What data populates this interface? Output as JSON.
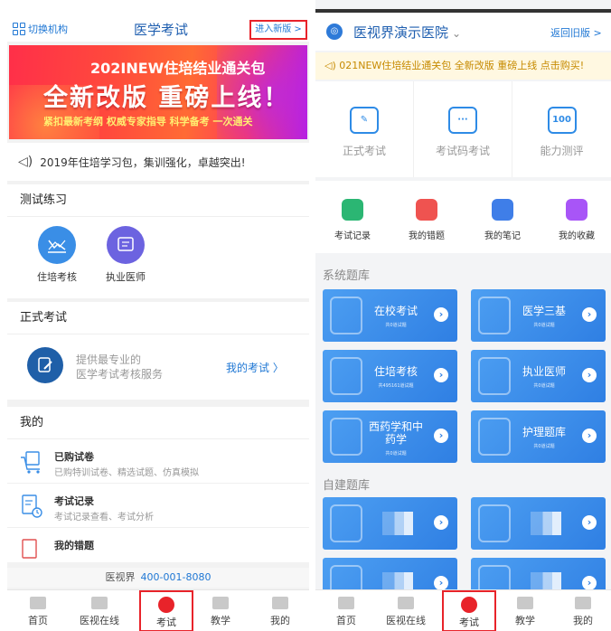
{
  "left": {
    "header": {
      "switch_label": "切换机构",
      "title": "医学考试",
      "new_version_label": "进入新版 >"
    },
    "banner": {
      "line1": "202INEW住培结业通关包",
      "line2": "全新改版 重磅上线！",
      "line3": "紧扣最新考纲  权威专家指导  科学备考  一次通关"
    },
    "notice": "2019年住培学习包，集训强化，卓越突出!",
    "practice": {
      "title": "测试练习",
      "items": [
        {
          "label": "住培考核"
        },
        {
          "label": "执业医师"
        }
      ]
    },
    "formal": {
      "title": "正式考试",
      "desc_line1": "提供最专业的",
      "desc_line2": "医学考试考核服务",
      "link": "我的考试  〉"
    },
    "mine": {
      "title": "我的",
      "items": [
        {
          "title": "已购试卷",
          "subtitle": "已购特训试卷、精选试题、仿真模拟"
        },
        {
          "title": "考试记录",
          "subtitle": "考试记录查看、考试分析"
        },
        {
          "title": "我的错题",
          "subtitle": ""
        }
      ]
    },
    "hotline": {
      "label": "医视界",
      "number": "400-001-8080"
    },
    "tabs": [
      {
        "label": "首页"
      },
      {
        "label": "医视在线"
      },
      {
        "label": "考试"
      },
      {
        "label": "教学"
      },
      {
        "label": "我的"
      }
    ]
  },
  "right": {
    "header": {
      "logo": "◎",
      "hospital": "医视界演示医院",
      "chevron": "⌄",
      "old_version_label": "返回旧版 >"
    },
    "notice": "◁) 021NEW住培结业通关包 全新改版 重磅上线 点击购买!",
    "modes": [
      {
        "label": "正式考试",
        "glyph": "✎"
      },
      {
        "label": "考试码考试",
        "glyph": "···"
      },
      {
        "label": "能力测评",
        "glyph": "100"
      }
    ],
    "quick": [
      {
        "label": "考试记录",
        "color": "#2bb673"
      },
      {
        "label": "我的错题",
        "color": "#ef5350"
      },
      {
        "label": "我的笔记",
        "color": "#3f7ee8"
      },
      {
        "label": "我的收藏",
        "color": "#a855f7"
      }
    ],
    "system_section": "系统题库",
    "system_banks": [
      {
        "title": "在校考试",
        "sub": "共0道试题"
      },
      {
        "title": "医学三基",
        "sub": "共0道试题"
      },
      {
        "title": "住培考核",
        "sub": "共495161道试题"
      },
      {
        "title": "执业医师",
        "sub": "共0道试题"
      },
      {
        "title": "西药学和中药学",
        "sub": "共0道试题"
      },
      {
        "title": "护理题库",
        "sub": "共0道试题"
      }
    ],
    "custom_section": "自建题库",
    "tabs": [
      {
        "label": "首页"
      },
      {
        "label": "医视在线"
      },
      {
        "label": "考试"
      },
      {
        "label": "教学"
      },
      {
        "label": "我的"
      }
    ]
  },
  "colors": {
    "primary": "#1f77d4",
    "highlight_box": "#e8232a",
    "bank_blue": "#3a8bec"
  }
}
